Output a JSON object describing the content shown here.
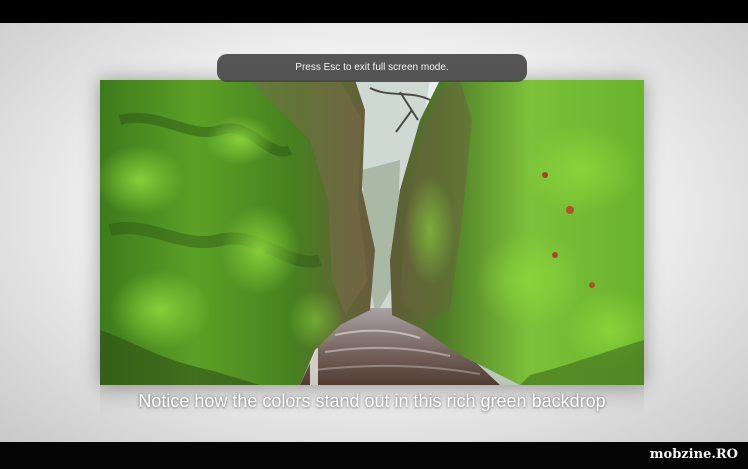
{
  "overlay": {
    "exit_fullscreen_hint": "Press Esc to exit full screen mode."
  },
  "slide": {
    "caption": "Notice how the colors stand out in this rich green backdrop"
  },
  "watermark": {
    "text": "mobzine.RO"
  },
  "colors": {
    "moss_bright": "#6fbf2a",
    "moss_dark": "#2f5a1a",
    "rock": "#5b4a36",
    "water": "#8a7a78",
    "sky": "#dfe7ea"
  }
}
